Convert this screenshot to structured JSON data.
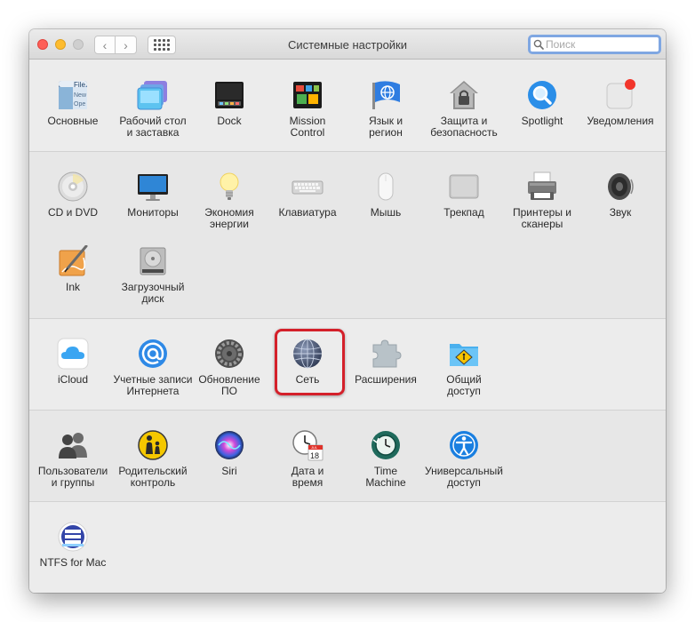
{
  "window": {
    "title": "Системные настройки",
    "search": {
      "placeholder": "Поиск",
      "value": ""
    }
  },
  "accent": {
    "highlight_border": "#d4202a",
    "search_focus": "#7fa7e2"
  },
  "panes": {
    "general": {
      "label": "Основные",
      "icon": "file-window-icon"
    },
    "desktop": {
      "label": "Рабочий стол\nи заставка",
      "icon": "desktop-screensaver-icon"
    },
    "dock": {
      "label": "Dock",
      "icon": "dock-icon"
    },
    "mission_control": {
      "label": "Mission\nControl",
      "icon": "mission-control-icon"
    },
    "language": {
      "label": "Язык и\nрегион",
      "icon": "globe-flag-icon"
    },
    "security": {
      "label": "Защита и\nбезопасность",
      "icon": "house-lock-icon"
    },
    "spotlight": {
      "label": "Spotlight",
      "icon": "spotlight-magnifier-icon"
    },
    "notifications": {
      "label": "Уведомления",
      "icon": "notifications-icon"
    },
    "cd_dvd": {
      "label": "CD и DVD",
      "icon": "disc-icon"
    },
    "displays": {
      "label": "Мониторы",
      "icon": "monitor-icon"
    },
    "energy": {
      "label": "Экономия\nэнергии",
      "icon": "lightbulb-icon"
    },
    "keyboard": {
      "label": "Клавиатура",
      "icon": "keyboard-icon"
    },
    "mouse": {
      "label": "Мышь",
      "icon": "mouse-icon"
    },
    "trackpad": {
      "label": "Трекпад",
      "icon": "trackpad-icon"
    },
    "printers": {
      "label": "Принтеры и\nсканеры",
      "icon": "printer-icon"
    },
    "sound": {
      "label": "Звук",
      "icon": "speaker-icon"
    },
    "ink": {
      "label": "Ink",
      "icon": "ink-pen-icon"
    },
    "startup_disk": {
      "label": "Загрузочный\nдиск",
      "icon": "hard-disk-icon"
    },
    "icloud": {
      "label": "iCloud",
      "icon": "cloud-icon"
    },
    "internet_accounts": {
      "label": "Учетные записи\nИнтернета",
      "icon": "at-sign-icon"
    },
    "software_update": {
      "label": "Обновление\nПО",
      "icon": "gear-icon"
    },
    "network": {
      "label": "Сеть",
      "icon": "network-globe-icon"
    },
    "extensions": {
      "label": "Расширения",
      "icon": "puzzle-piece-icon"
    },
    "sharing": {
      "label": "Общий\nдоступ",
      "icon": "shared-folder-icon"
    },
    "users": {
      "label": "Пользователи\nи группы",
      "icon": "users-silhouette-icon"
    },
    "parental": {
      "label": "Родительский\nконтроль",
      "icon": "parental-controls-icon"
    },
    "siri": {
      "label": "Siri",
      "icon": "siri-icon"
    },
    "datetime": {
      "label": "Дата и\nвремя",
      "icon": "clock-calendar-icon"
    },
    "time_machine": {
      "label": "Time\nMachine",
      "icon": "time-machine-icon"
    },
    "accessibility": {
      "label": "Универсальный\nдоступ",
      "icon": "accessibility-icon"
    },
    "ntfs": {
      "label": "NTFS for Mac",
      "icon": "ntfs-drive-icon"
    }
  },
  "general_icon_text": [
    "File",
    "New",
    "Ope"
  ],
  "datetime_icon_text": {
    "month": "JUL",
    "day": "18"
  }
}
